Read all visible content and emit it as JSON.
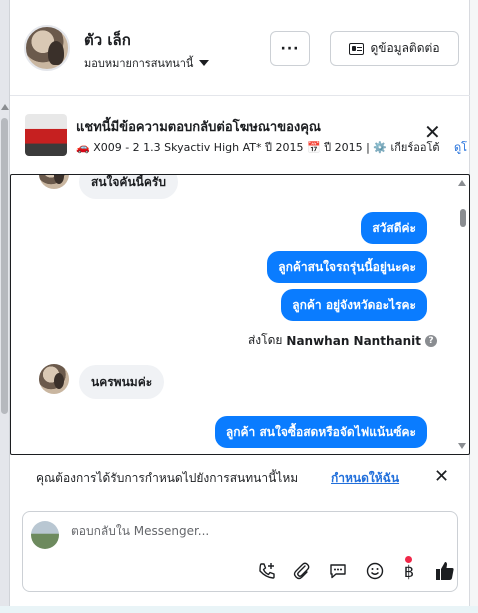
{
  "header": {
    "name": "ตัว เล็ก",
    "assign_label": "มอบหมายการสนทนานี้",
    "more_label": "···",
    "contact_button": "ดูข้อมูลติดต่อ"
  },
  "ad_reply": {
    "title": "แชทนี้มีข้อความตอบกลับต่อโฆษณาของคุณ",
    "subtitle": "🚗 X009 - 2 1.3 Skyactiv High AT* ปี 2015 📅 ปี 2015 | ⚙️ เกียร์ออโต้",
    "link": "ดูโ"
  },
  "messages": [
    {
      "dir": "in",
      "text": "สนใจคันนี้ครับ"
    },
    {
      "dir": "out",
      "text": "สวัสดีค่ะ"
    },
    {
      "dir": "out",
      "text": "ลูกค้าสนใจรถรุ่นนี้อยู่นะคะ"
    },
    {
      "dir": "out",
      "text": "ลูกค้า  อยู่จังหวัดอะไรคะ"
    },
    {
      "dir": "in",
      "text": "นครพนมค่ะ"
    },
    {
      "dir": "out",
      "text": "ลูกค้า  สนใจซื้อสดหรือจัดไฟแน้นซ์คะ"
    }
  ],
  "sent_by": {
    "prefix": "ส่งโดย",
    "agent": "Nanwhan Nanthanit"
  },
  "notice": {
    "text": "คุณต้องการได้รับการกำหนดไปยังการสนทนานี้ไหม",
    "link": "กำหนดให้ฉัน"
  },
  "composer": {
    "placeholder": "ตอบกลับใน Messenger..."
  },
  "colors": {
    "outgoing_bubble": "#0a7cff",
    "link": "#216fdb",
    "notification_dot": "#f02849"
  }
}
